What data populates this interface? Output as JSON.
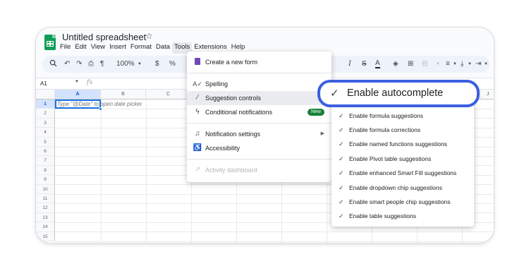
{
  "header": {
    "title": "Untitled spreadsheet",
    "menus": [
      "File",
      "Edit",
      "View",
      "Insert",
      "Format",
      "Data",
      "Tools",
      "Extensions",
      "Help"
    ],
    "active_menu": "Tools"
  },
  "toolbar": {
    "zoom": "100%",
    "currency": "$",
    "percent": "%"
  },
  "formula_bar": {
    "cell_ref": "A1",
    "fx": "fx"
  },
  "grid": {
    "columns": [
      "A",
      "B",
      "C",
      "J"
    ],
    "rows": [
      "1",
      "2",
      "3",
      "4",
      "5",
      "6",
      "7",
      "8",
      "9",
      "10",
      "11",
      "12",
      "13",
      "14",
      "15"
    ],
    "a1_hint": "Type \"@Date\" to open date picker"
  },
  "tools_menu": {
    "items": [
      {
        "label": "Create a new form",
        "icon": "form-icon"
      },
      {
        "label": "Spelling",
        "icon": "spelling-icon"
      },
      {
        "label": "Suggestion controls",
        "icon": "magic-wand-icon",
        "highlighted": true
      },
      {
        "label": "Conditional notifications",
        "icon": "bolt-icon",
        "badge": "New"
      },
      {
        "label": "Notification settings",
        "icon": "bell-icon",
        "submenu": true
      },
      {
        "label": "Accessibility",
        "icon": "accessibility-icon"
      },
      {
        "label": "Activity dashboard",
        "icon": "trend-icon",
        "disabled": true
      }
    ]
  },
  "suggestion_submenu": {
    "callout": "Enable autocomplete",
    "items": [
      "Enable formula suggestions",
      "Enable formula corrections",
      "Enable named functions suggestions",
      "Enable Pivot table suggestions",
      "Enable enhanced Smart Fill suggestions",
      "Enable dropdown chip suggestions",
      "Enable smart people chip suggestions",
      "Enable table suggestions"
    ]
  },
  "colors": {
    "accent_blue": "#3c5fe0",
    "selection_blue": "#1a73e8",
    "sheets_green": "#0f9d58",
    "badge_green": "#188038"
  }
}
